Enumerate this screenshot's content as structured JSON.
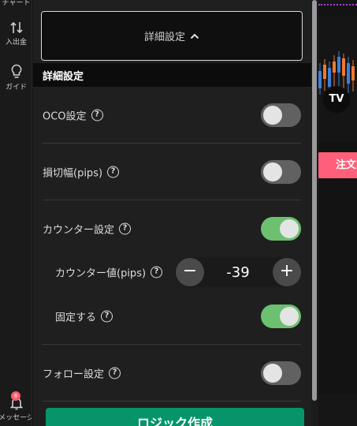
{
  "colors": {
    "toggle_on": "#6cc070",
    "toggle_off": "#616161",
    "create_button": "#06956a",
    "order_button": "#ff5f7a",
    "badge": "#ff5a6e"
  },
  "nav": {
    "chart_label": "チャート",
    "deposit_label": "入出金",
    "guide_label": "ガイド",
    "messages_label": "メッセージ",
    "messages_badge": "8"
  },
  "panel": {
    "collapse_label": "詳細設定",
    "section_title": "詳細設定",
    "settings": [
      {
        "label": "OCO設定",
        "icon": "help-circle-icon",
        "enabled": false
      },
      {
        "label": "損切幅(pips)",
        "icon": "help-circle-icon",
        "enabled": false
      },
      {
        "label": "カウンター設定",
        "icon": "help-circle-icon",
        "enabled": true
      },
      {
        "label": "カウンター値(pips)",
        "icon": "help-circle-icon",
        "value": "-39"
      },
      {
        "label": "固定する",
        "icon": "help-circle-icon",
        "enabled": true
      },
      {
        "label": "フォロー設定",
        "icon": "help-circle-icon",
        "enabled": false
      }
    ],
    "create_button": "ロジック作成"
  },
  "chart": {
    "order_button": "注文",
    "logo": "TV"
  }
}
